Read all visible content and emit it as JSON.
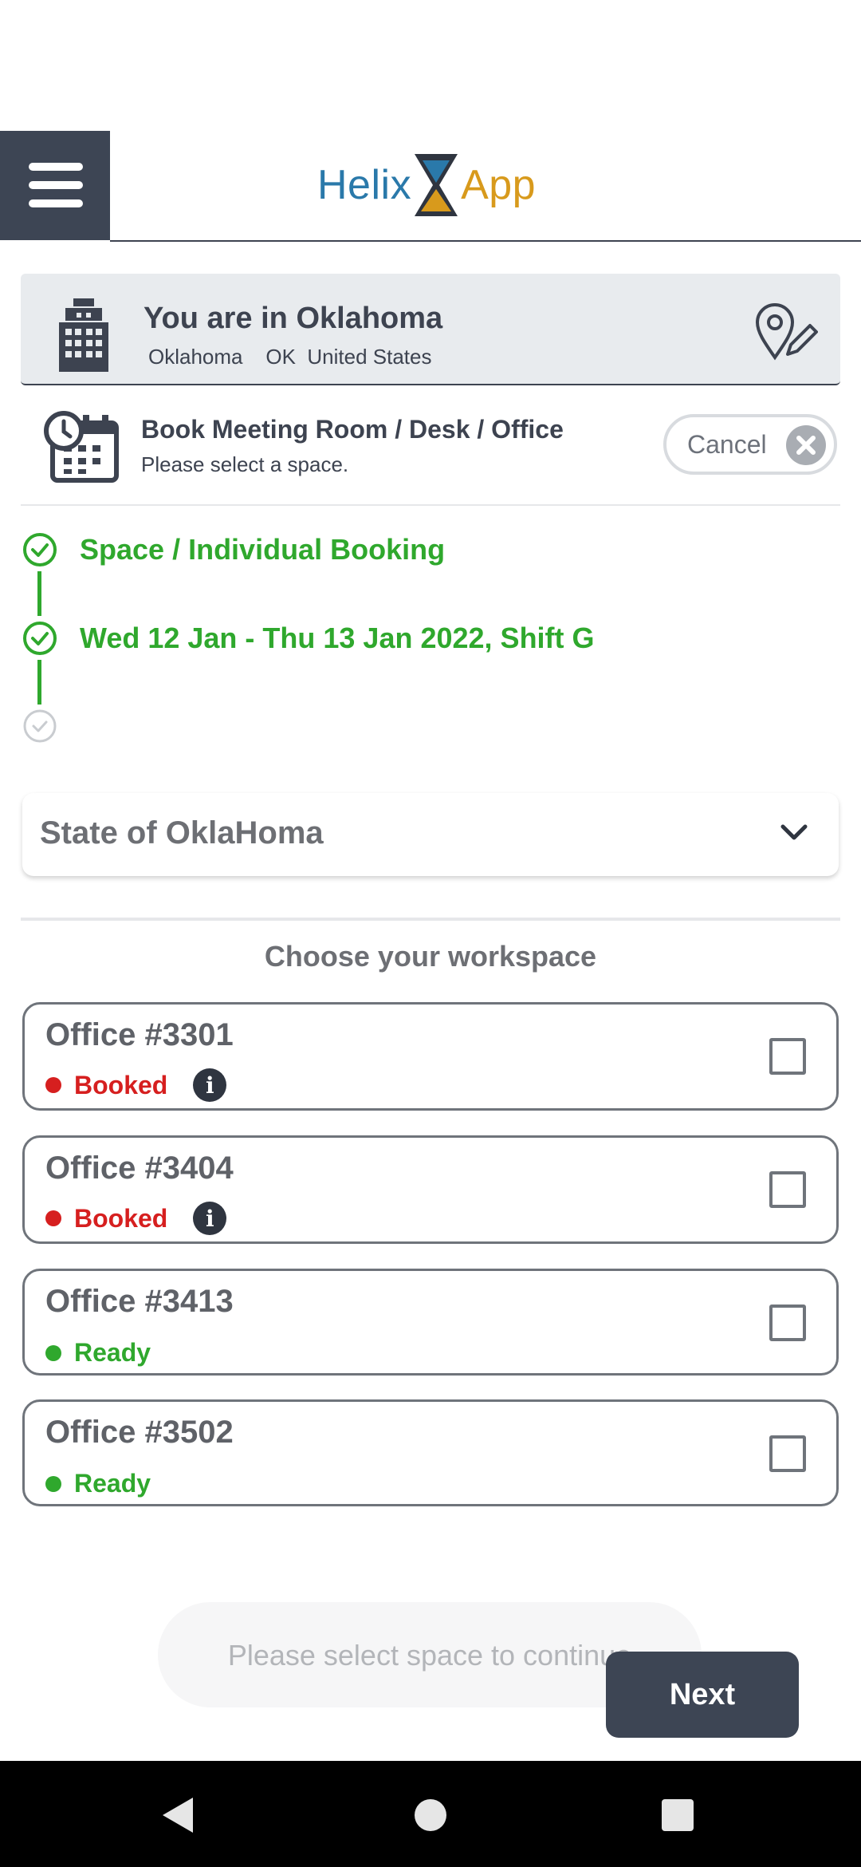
{
  "header": {
    "logo_left": "Helix",
    "logo_right": "App",
    "menu_icon": "hamburger-menu-icon"
  },
  "location": {
    "title": "You are in Oklahoma",
    "subtitle": "Oklahoma    OK  United States",
    "building_icon": "building-icon",
    "edit_location_icon": "location-edit-icon"
  },
  "booking": {
    "title": "Book Meeting Room / Desk / Office",
    "subtitle": "Please select a space.",
    "icon": "calendar-clock-icon",
    "cancel_label": "Cancel"
  },
  "steps": [
    {
      "label": "Space / Individual Booking",
      "done": true
    },
    {
      "label": "Wed 12 Jan - Thu 13 Jan 2022, Shift G",
      "done": true
    },
    {
      "label": "",
      "done": false
    }
  ],
  "dropdown": {
    "value": "State of OklaHoma",
    "icon": "chevron-down-icon"
  },
  "workspace": {
    "heading": "Choose your workspace",
    "offices": [
      {
        "name": "Office #3301",
        "status": "Booked",
        "status_color": "#d61f1f",
        "info": true
      },
      {
        "name": "Office #3404",
        "status": "Booked",
        "status_color": "#d61f1f",
        "info": true
      },
      {
        "name": "Office #3413",
        "status": "Ready",
        "status_color": "#2fa82d",
        "info": false
      },
      {
        "name": "Office #3502",
        "status": "Ready",
        "status_color": "#2fa82d",
        "info": false
      }
    ]
  },
  "footer": {
    "toast": "Please select space to continue",
    "next_label": "Next"
  },
  "colors": {
    "primary_dark": "#3d4554",
    "success": "#2fa82d",
    "danger": "#d61f1f",
    "brand_blue": "#2a79aa",
    "brand_gold": "#d89a1c"
  }
}
